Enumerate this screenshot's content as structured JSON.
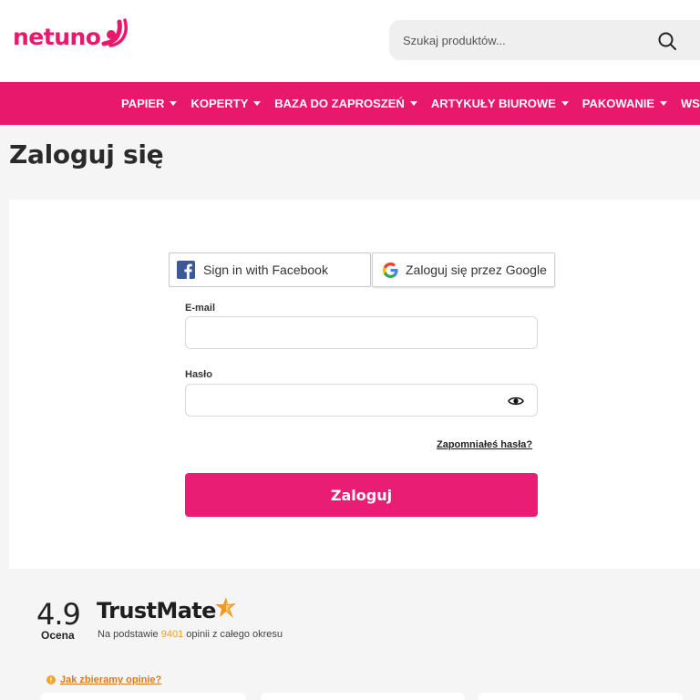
{
  "brand": {
    "name": "netuno",
    "accent": "#e8196c"
  },
  "search": {
    "placeholder": "Szukaj produktów...",
    "icon": "search-icon"
  },
  "nav": {
    "items": [
      {
        "label": "PAPIER"
      },
      {
        "label": "KOPERTY"
      },
      {
        "label": "BAZA DO ZAPROSZEŃ"
      },
      {
        "label": "ARTYKUŁY BIUROWE"
      },
      {
        "label": "PAKOWANIE"
      },
      {
        "label": "WSTĄŻKI"
      }
    ]
  },
  "page": {
    "title": "Zaloguj się"
  },
  "login": {
    "facebook_label": "Sign in with Facebook",
    "google_label": "Zaloguj się przez Google",
    "email_label": "E-mail",
    "email_value": "",
    "password_label": "Hasło",
    "password_value": "",
    "forgot_label": "Zapomniałeś hasła?",
    "submit_label": "Zaloguj",
    "submit_color": "#ea1d75"
  },
  "trustmate": {
    "rating": "4.9",
    "rating_caption": "Ocena",
    "brand": "TrustMate",
    "desc_before": "Na podstawie ",
    "review_count": "9401",
    "desc_after": " opinii z całego okresu",
    "how_label": "Jak zbieramy opinie?"
  }
}
